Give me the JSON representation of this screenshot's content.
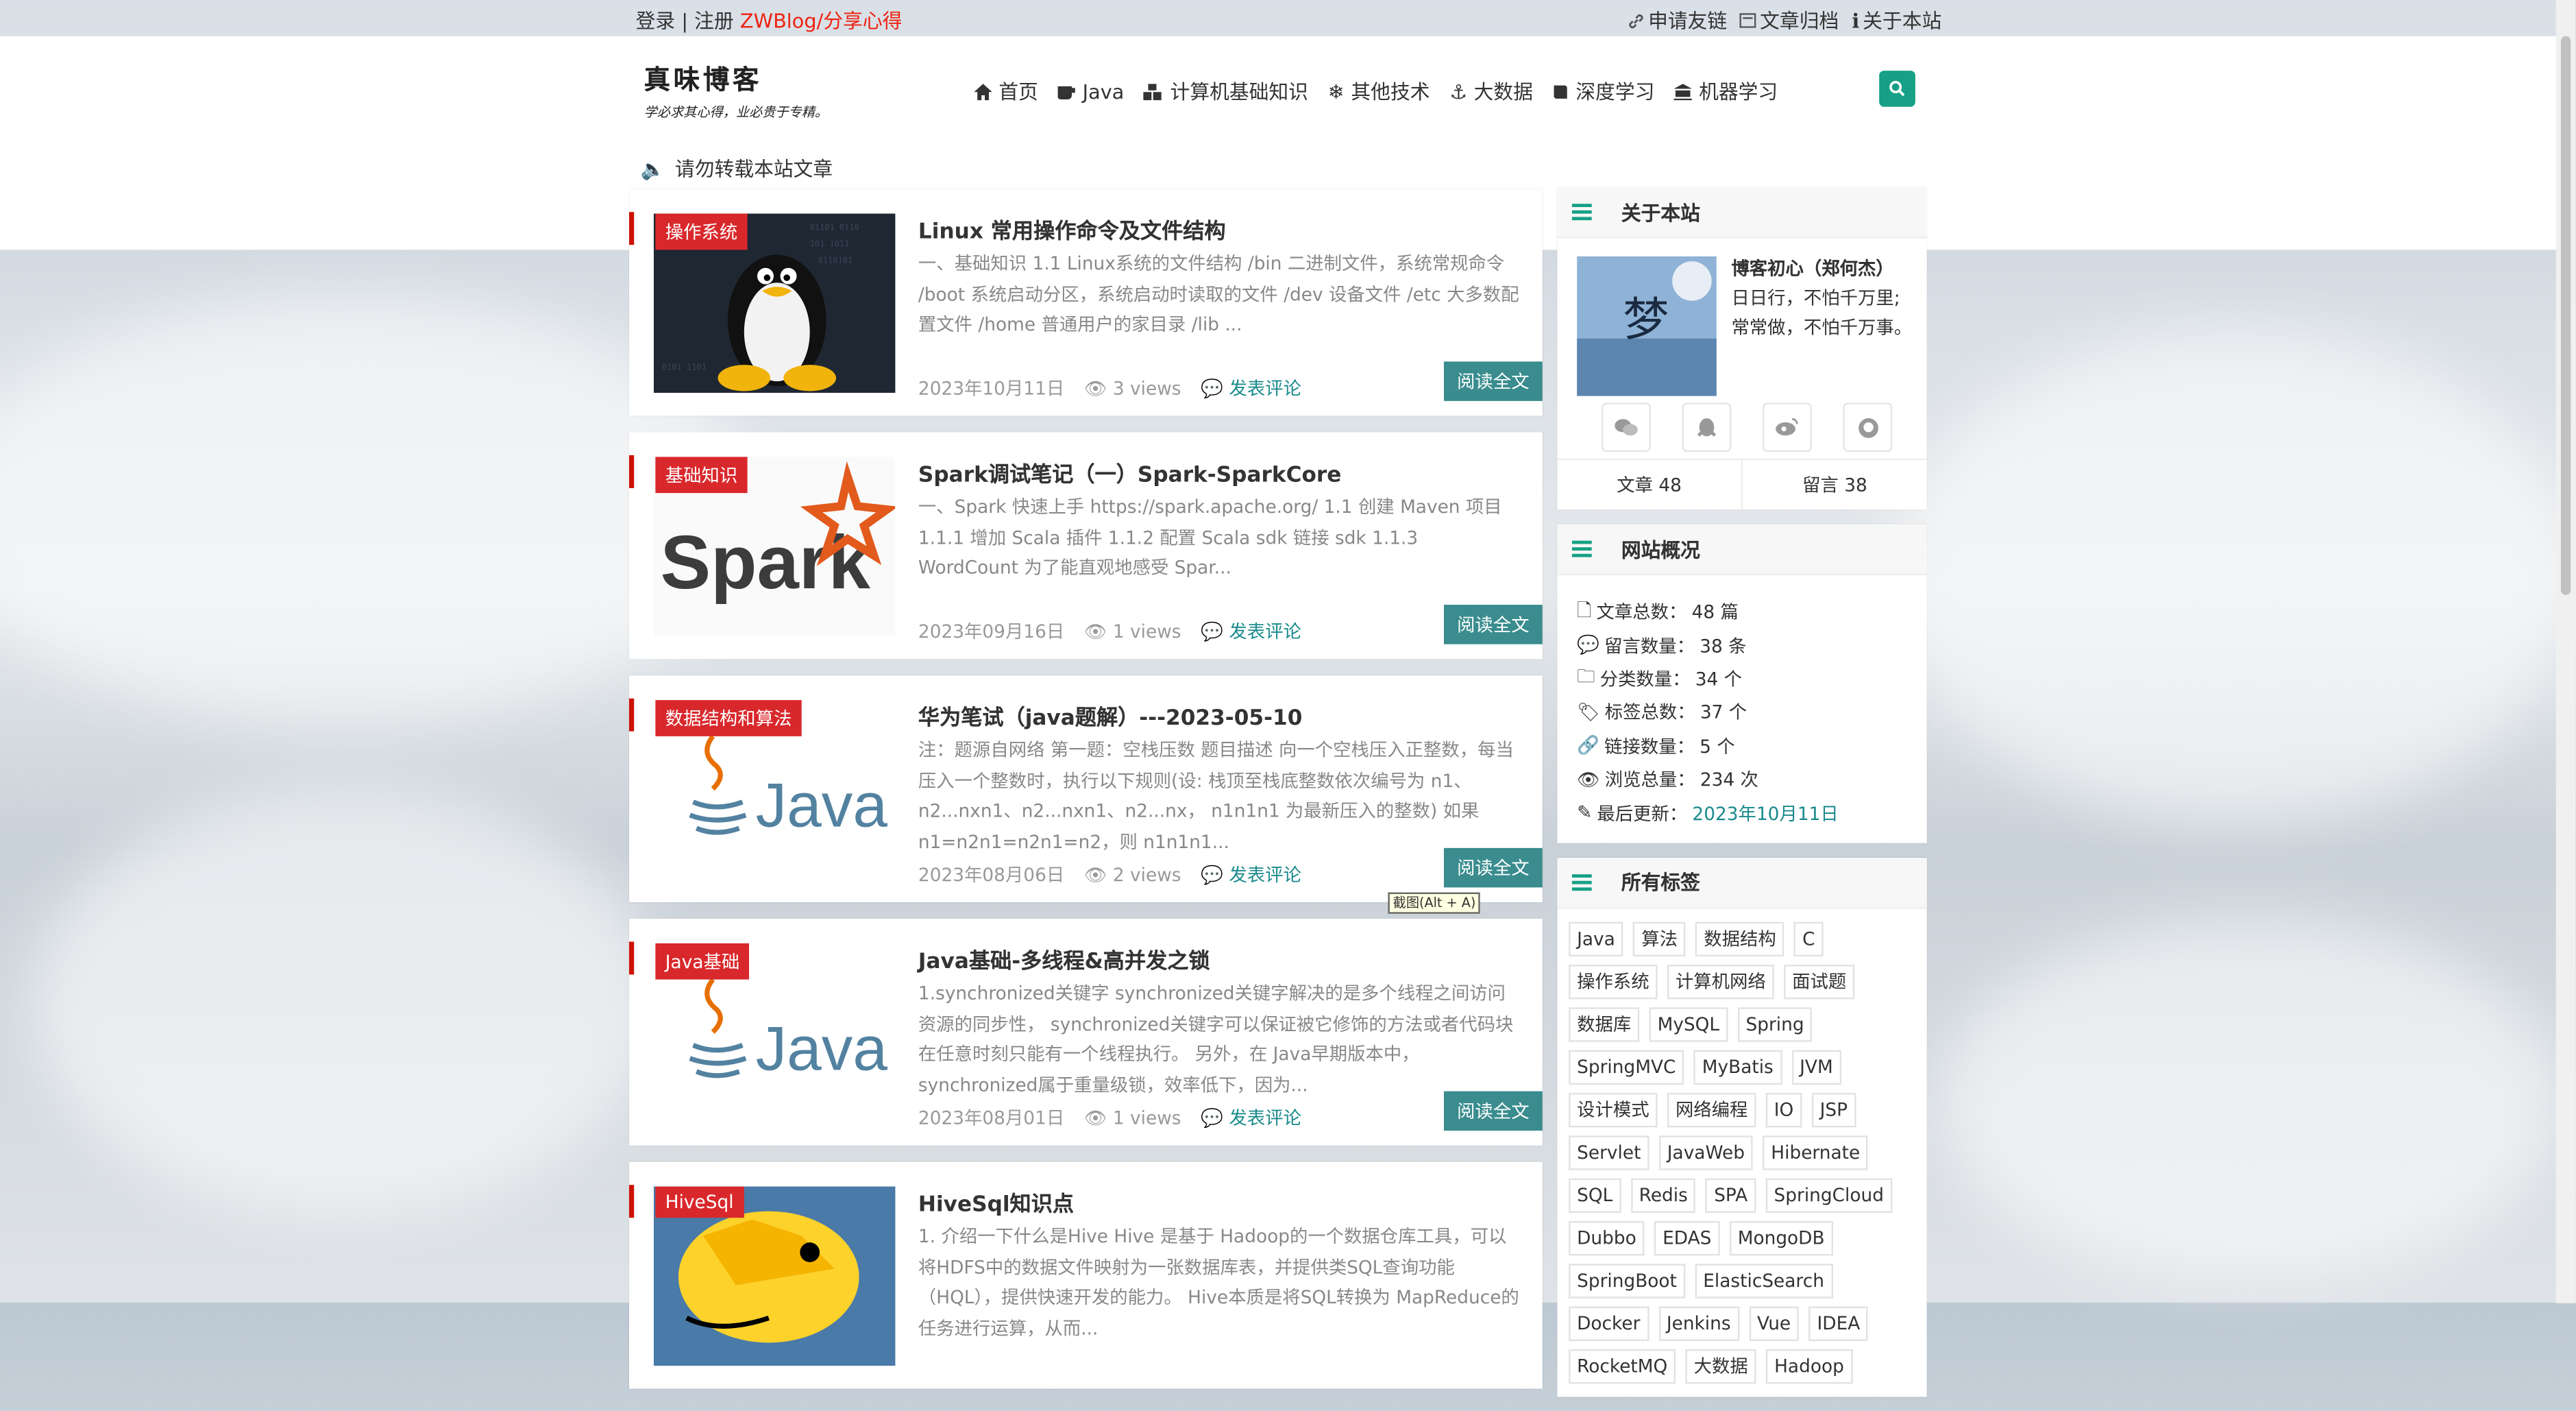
{
  "topbar": {
    "login": "登录",
    "sep": " | ",
    "register": "注册",
    "slogan": "ZWBlog/分享心得",
    "links": [
      "申请友链",
      "文章归档",
      "关于本站"
    ]
  },
  "logo": {
    "title": "真味博客",
    "subtitle": "学必求其心得，业必贵于专精。"
  },
  "nav": {
    "items": [
      {
        "label": "首页",
        "icon": "home-icon"
      },
      {
        "label": "Java",
        "icon": "coffee-icon"
      },
      {
        "label": "计算机基础知识",
        "icon": "cubes-icon"
      },
      {
        "label": "其他技术",
        "icon": "snowflake-icon"
      },
      {
        "label": "大数据",
        "icon": "anchor-icon"
      },
      {
        "label": "深度学习",
        "icon": "book-icon"
      },
      {
        "label": "机器学习",
        "icon": "bank-icon"
      }
    ]
  },
  "notice": "请勿转载本站文章",
  "posts": [
    {
      "category": "操作系统",
      "title": "Linux 常用操作命令及文件结构",
      "excerpt": "一、基础知识 1.1 Linux系统的文件结构 /bin 二进制文件，系统常规命令 /boot 系统启动分区，系统启动时读取的文件 /dev 设备文件 /etc 大多数配置文件 /home 普通用户的家目录 /lib ...",
      "date": "2023年10月11日",
      "views": "3 views",
      "comment": "发表评论",
      "read": "阅读全文",
      "image": "linux-tux"
    },
    {
      "category": "基础知识",
      "title": "Spark调试笔记（一）Spark-SparkCore",
      "excerpt": " 一、Spark 快速上手 https://spark.apache.org/ 1.1 创建 Maven 项目 1.1.1 增加 Scala 插件 1.1.2 配置 Scala sdk 链接 sdk 1.1.3 WordCount 为了能直观地感受 Spar...",
      "date": "2023年09月16日",
      "views": "1 views",
      "comment": "发表评论",
      "read": "阅读全文",
      "image": "spark-logo"
    },
    {
      "category": "数据结构和算法",
      "title": "华为笔试（java题解）---2023-05-10",
      "excerpt": "注：题源自网络 第一题：空栈压数 题目描述 向一个空栈压入正整数，每当压入一个整数时，执行以下规则(设: 栈顶至栈底整数依次编号为 n1、n2...nxn1、n2...nxn1、n2...nx， n1n1n1 为最新压入的整数) 如果 n1=n2n1=n2n1=n2，则 n1n1n1...",
      "date": "2023年08月06日",
      "views": "2 views",
      "comment": "发表评论",
      "read": "阅读全文",
      "image": "java-logo"
    },
    {
      "category": "Java基础",
      "title": "Java基础-多线程&高并发之锁",
      "excerpt": "1.synchronized关键字 synchronized关键字解决的是多个线程之间访问资源的同步性， synchronized关键字可以保证被它修饰的方法或者代码块在任意时刻只能有一个线程执行。 另外，在 Java早期版本中，synchronized属于重量级锁，效率低下，因为...",
      "date": "2023年08月01日",
      "views": "1 views",
      "comment": "发表评论",
      "read": "阅读全文",
      "image": "java-logo"
    },
    {
      "category": "HiveSql",
      "title": "HiveSql知识点",
      "excerpt": "1. 介绍一下什么是Hive Hive 是基于 Hadoop的一个数据仓库工具，可以将HDFS中的数据文件映射为一张数据库表，并提供类SQL查询功能（HQL），提供快速开发的能力。 Hive本质是将SQL转换为 MapReduce的任务进行运算，从而...",
      "date": "",
      "views": "",
      "comment": "",
      "read": "",
      "image": "hive-logo"
    }
  ],
  "about": {
    "title": "关于本站",
    "name": "博客初心（郑何杰）",
    "desc1": "日日行，不怕千万里;",
    "desc2": "常常做，不怕千万事。",
    "articles": "文章 48",
    "messages": "留言 38",
    "socials": [
      "wechat-icon",
      "qq-icon",
      "weibo-icon",
      "github-icon"
    ]
  },
  "overview": {
    "title": "网站概况",
    "rows": [
      {
        "icon": "file-icon",
        "label": "文章总数：",
        "value": "48 篇"
      },
      {
        "icon": "comment-icon",
        "label": "留言数量：",
        "value": "38 条"
      },
      {
        "icon": "folder-icon",
        "label": "分类数量：",
        "value": "34 个"
      },
      {
        "icon": "tags-icon",
        "label": "标签总数：",
        "value": "37 个"
      },
      {
        "icon": "link-icon",
        "label": "链接数量：",
        "value": "5 个"
      },
      {
        "icon": "eye-icon",
        "label": "浏览总量：",
        "value": "234 次"
      },
      {
        "icon": "edit-icon",
        "label": "最后更新：",
        "value": "2023年10月11日"
      }
    ]
  },
  "tags": {
    "title": "所有标签",
    "items": [
      "Java",
      "算法",
      "数据结构",
      "C",
      "操作系统",
      "计算机网络",
      "面试题",
      "数据库",
      "MySQL",
      "Spring",
      "SpringMVC",
      "MyBatis",
      "JVM",
      "设计模式",
      "网络编程",
      "IO",
      "JSP",
      "Servlet",
      "JavaWeb",
      "Hibernate",
      "SQL",
      "Redis",
      "SPA",
      "SpringCloud",
      "Dubbo",
      "EDAS",
      "MongoDB",
      "SpringBoot",
      "ElasticSearch",
      "Docker",
      "Jenkins",
      "Vue",
      "IDEA",
      "RocketMQ",
      "大数据",
      "Hadoop"
    ]
  },
  "tooltip": "截图(Alt + A)",
  "colors": {
    "accent": "#16a085",
    "category": "#d9282c",
    "read": "#3a8c8e",
    "slogan": "#ee2211"
  }
}
